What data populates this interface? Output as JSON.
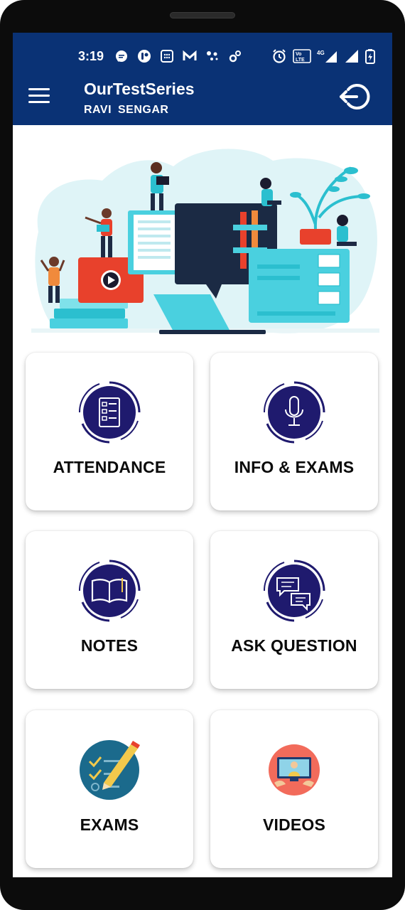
{
  "status_bar": {
    "time": "3:19",
    "icons_left": [
      "message-icon",
      "app-notification-icon",
      "calendar-icon",
      "gmail-icon",
      "dots-icon",
      "settings-icon"
    ],
    "icons_right": [
      "alarm-icon",
      "volte-icon",
      "4g-signal-icon",
      "signal-icon",
      "battery-icon"
    ]
  },
  "app_bar": {
    "title": "OurTestSeries",
    "subtitle": "RAVI SENGAR",
    "menu_icon": "hamburger-menu-icon",
    "logout_icon": "logout-icon",
    "color": "#0a3275"
  },
  "cards": [
    {
      "label": "ATTENDANCE",
      "icon": "attendance-list-icon"
    },
    {
      "label": "INFO & EXAMS",
      "icon": "microphone-icon"
    },
    {
      "label": "NOTES",
      "icon": "open-book-icon"
    },
    {
      "label": "ASK QUESTION",
      "icon": "chat-bubbles-icon"
    },
    {
      "label": "EXAMS",
      "icon": "exam-checklist-icon"
    },
    {
      "label": "VIDEOS",
      "icon": "video-lesson-icon"
    }
  ],
  "colors": {
    "primary": "#0a3275",
    "icon_circle": "#1f1a6e",
    "accent_teal": "#2bbfcf",
    "accent_red": "#e8412c"
  }
}
